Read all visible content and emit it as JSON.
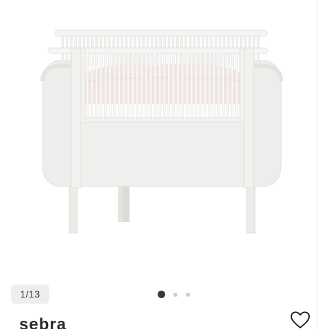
{
  "gallery": {
    "counter": "1/13",
    "dots": [
      {
        "active": true
      },
      {
        "active": false
      },
      {
        "active": false
      }
    ]
  },
  "product": {
    "brand": "sebra"
  },
  "icons": {
    "favorite": "heart-outline-icon"
  },
  "colors": {
    "crib": "#f2f2f0",
    "bedding": "#f3e4df",
    "dot_active": "#3a3a3a",
    "dot_inactive": "#cccccc"
  }
}
